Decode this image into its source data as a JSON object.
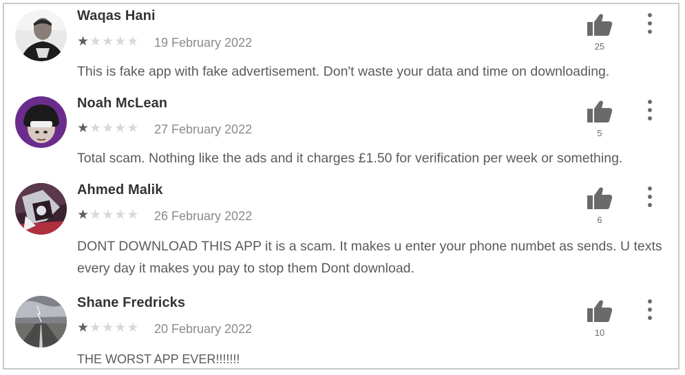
{
  "colors": {
    "star_filled": "#5f5f5f",
    "star_empty": "#d8d8d8",
    "icon": "#6a6a6a"
  },
  "reviews": [
    {
      "name": "Waqas Hani",
      "rating": 1,
      "max_rating": 5,
      "date": "19 February 2022",
      "text": "This is fake app with fake advertisement. Don't waste your data and time on downloading.",
      "helpful_count": "25",
      "avatar_icon": "user-avatar"
    },
    {
      "name": "Noah McLean",
      "rating": 1,
      "max_rating": 5,
      "date": "27 February 2022",
      "text": "Total scam. Nothing like the ads and it charges £1.50 for verification per week or something.",
      "helpful_count": "5",
      "avatar_icon": "user-avatar"
    },
    {
      "name": "Ahmed Malik",
      "rating": 1,
      "max_rating": 5,
      "date": "26 February 2022",
      "text": "DONT DOWNLOAD THIS APP it is a scam. It makes u enter your phone numbet as sends. U texts every day it makes you pay to stop them Dont download.",
      "helpful_count": "6",
      "avatar_icon": "user-avatar"
    },
    {
      "name": "Shane Fredricks",
      "rating": 1,
      "max_rating": 5,
      "date": "20 February 2022",
      "text": "THE WORST APP EVER!!!!!!!",
      "helpful_count": "10",
      "avatar_icon": "user-avatar"
    }
  ]
}
